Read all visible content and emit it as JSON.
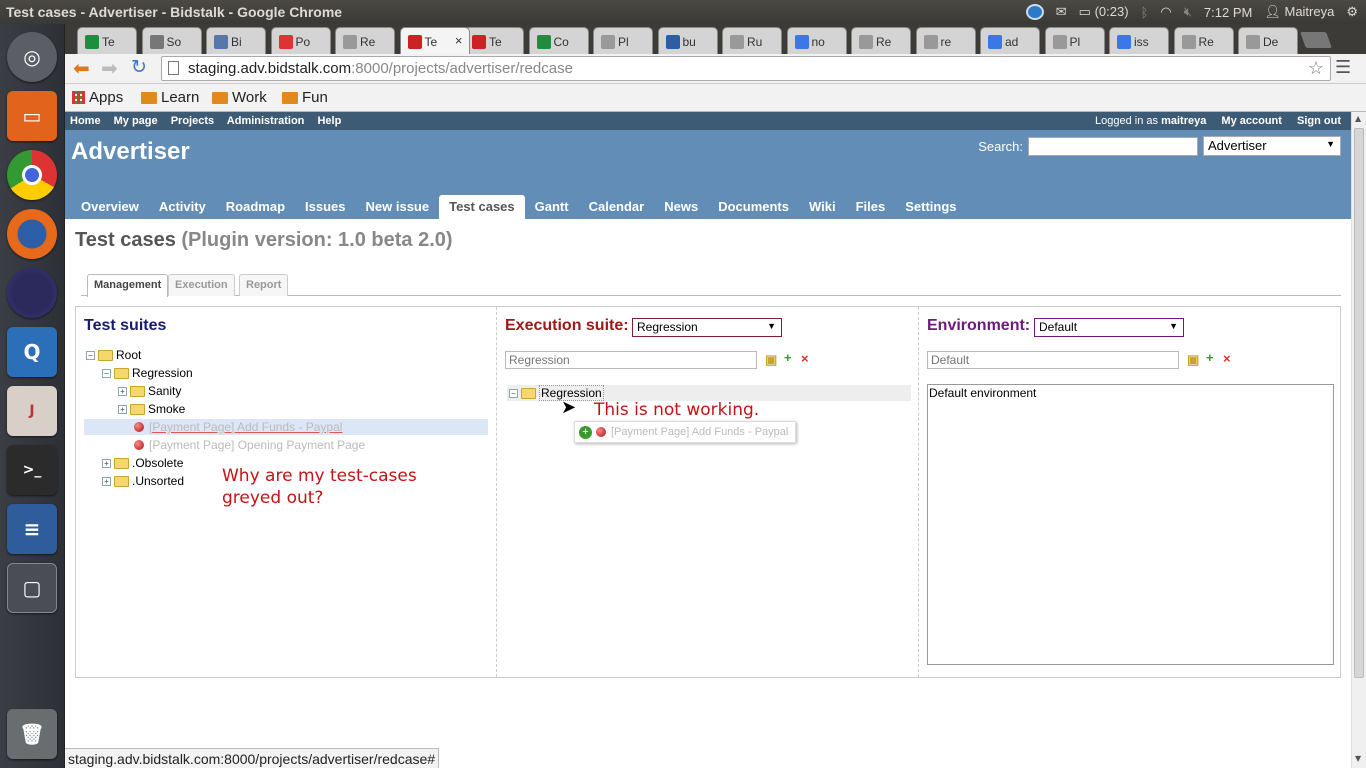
{
  "window": {
    "title": "Test cases - Advertiser - Bidstalk - Google Chrome"
  },
  "indicators": {
    "battery": "(0:23)",
    "time": "7:12 PM",
    "user": "Maitreya"
  },
  "tabs": [
    "Te",
    "So",
    "Bi",
    "Po",
    "Re",
    "Te",
    "Te",
    "Co",
    "Pl",
    "bu",
    "Ru",
    "no",
    "Re",
    "re",
    "ad",
    "Pl",
    "iss",
    "Re",
    "De"
  ],
  "address": {
    "host": "staging.adv.bidstalk.com",
    "path": ":8000/projects/advertiser/redcase"
  },
  "bookmarks": {
    "apps": "Apps",
    "items": [
      "Learn",
      "Work",
      "Fun"
    ]
  },
  "topmenu": {
    "home": "Home",
    "mypage": "My page",
    "projects": "Projects",
    "admin": "Administration",
    "help": "Help",
    "logged": "Logged in as",
    "user": "maitreya",
    "account": "My account",
    "signout": "Sign out"
  },
  "header": {
    "title": "Advertiser",
    "search_label": "Search:",
    "project_select": "Advertiser"
  },
  "mainmenu": [
    "Overview",
    "Activity",
    "Roadmap",
    "Issues",
    "New issue",
    "Test cases",
    "Gantt",
    "Calendar",
    "News",
    "Documents",
    "Wiki",
    "Files",
    "Settings"
  ],
  "heading": {
    "title": "Test cases",
    "version": "(Plugin version: 1.0 beta 2.0)"
  },
  "subtabs": [
    "Management",
    "Execution",
    "Report"
  ],
  "suites": {
    "title": "Test suites",
    "root": "Root",
    "regression": "Regression",
    "sanity": "Sanity",
    "smoke": "Smoke",
    "case1": "[Payment Page] Add Funds - Paypal",
    "case2": "[Payment Page] Opening Payment Page",
    "obsolete": ".Obsolete",
    "unsorted": ".Unsorted"
  },
  "execution": {
    "label": "Execution suite:",
    "selected": "Regression",
    "placeholder": "Regression",
    "node": "Regression",
    "drag_item": "[Payment Page] Add Funds - Paypal"
  },
  "environment": {
    "label": "Environment:",
    "selected": "Default",
    "placeholder": "Default",
    "desc": "Default environment"
  },
  "notes": {
    "greyed_line1": "Why are my test-cases",
    "greyed_line2": "greyed out?",
    "not_working": "This is not working."
  },
  "status": "staging.adv.bidstalk.com:8000/projects/advertiser/redcase#",
  "colors": {
    "header": "#628db6",
    "topmenu": "#3e5b76",
    "suites_title": "#1a1a6e",
    "exec_title": "#a01818",
    "env_title": "#6b1b7a",
    "annotation": "#c21414"
  }
}
